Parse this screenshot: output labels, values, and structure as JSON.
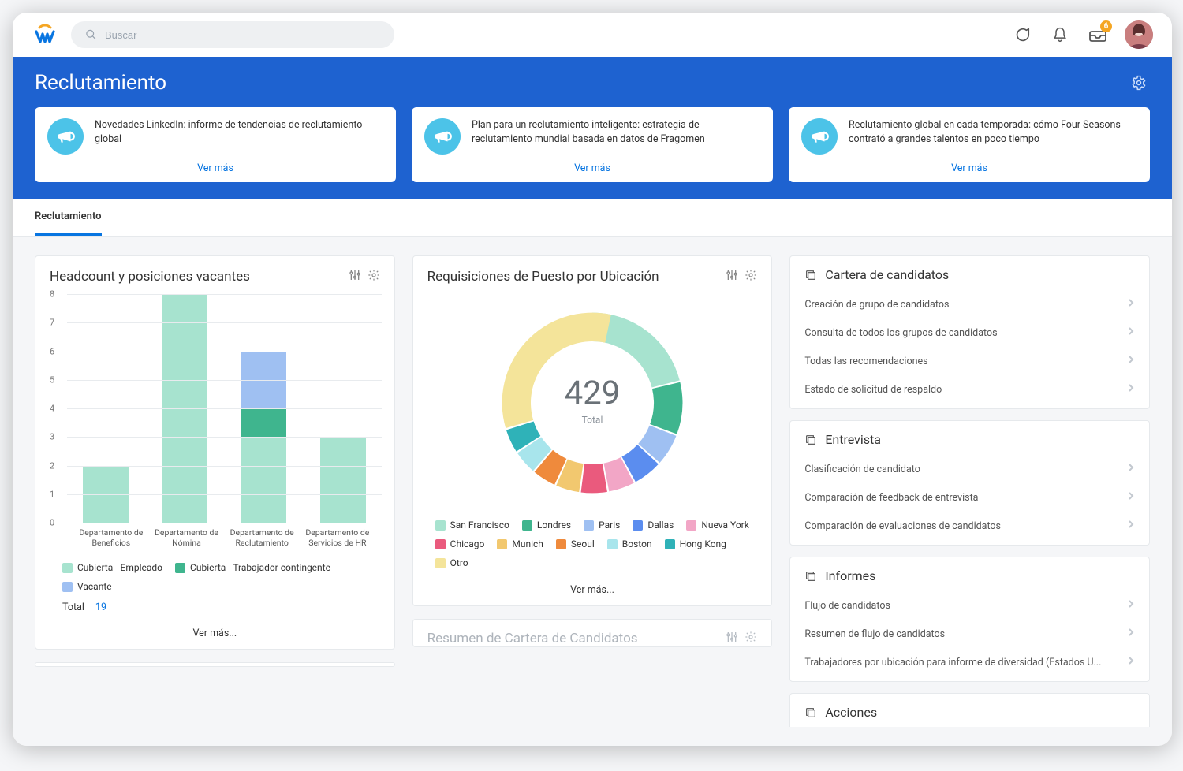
{
  "topbar": {
    "search_placeholder": "Buscar",
    "inbox_badge": "6"
  },
  "hero": {
    "title": "Reclutamiento",
    "cards": [
      {
        "text": "Novedades LinkedIn: informe de tendencias de reclutamiento global",
        "link": "Ver más"
      },
      {
        "text": "Plan para un reclutamiento inteligente: estrategia de reclutamiento mundial basada en datos de Fragomen",
        "link": "Ver más"
      },
      {
        "text": "Reclutamiento global en cada temporada: cómo Four Seasons contrató a grandes talentos en poco tiempo",
        "link": "Ver más"
      }
    ]
  },
  "tabs": {
    "active": "Reclutamiento"
  },
  "headcount": {
    "title": "Headcount y posiciones vacantes",
    "legend": {
      "filled_emp": "Cubierta - Empleado",
      "filled_cont": "Cubierta - Trabajador contingente",
      "vacant": "Vacante"
    },
    "total_label": "Total",
    "total_value": "19",
    "more": "Ver más..."
  },
  "requisitions": {
    "title": "Requisiciones de Puesto por Ubicación",
    "center_value": "429",
    "center_label": "Total",
    "legend": [
      "San Francisco",
      "Londres",
      "Paris",
      "Dallas",
      "Nueva York",
      "Chicago",
      "Munich",
      "Seoul",
      "Boston",
      "Hong Kong",
      "Otro"
    ],
    "more": "Ver más..."
  },
  "candidate_summary": {
    "title": "Resumen de Cartera de Candidatos"
  },
  "right": {
    "sections": [
      {
        "title": "Cartera de candidatos",
        "links": [
          "Creación de grupo de candidatos",
          "Consulta de todos los grupos de candidatos",
          "Todas las recomendaciones",
          "Estado de solicitud de respaldo"
        ]
      },
      {
        "title": "Entrevista",
        "links": [
          "Clasificación de candidato",
          "Comparación de feedback de entrevista",
          "Comparación de evaluaciones de candidatos"
        ]
      },
      {
        "title": "Informes",
        "links": [
          "Flujo de candidatos",
          "Resumen de flujo de candidatos",
          "Trabajadores por ubicación para informe de diversidad (Estados U..."
        ]
      },
      {
        "title": "Acciones",
        "links": []
      }
    ]
  },
  "chart_data": [
    {
      "type": "bar",
      "title": "Headcount y posiciones vacantes",
      "categories": [
        "Departamento de Beneficios",
        "Departamento de Nómina",
        "Departamento de Reclutamiento",
        "Departamento de Servicios de HR"
      ],
      "series": [
        {
          "name": "Cubierta - Empleado",
          "color": "#a7e3cf",
          "values": [
            2,
            8,
            3,
            3
          ]
        },
        {
          "name": "Cubierta - Trabajador contingente",
          "color": "#3fb58e",
          "values": [
            0,
            0,
            1,
            0
          ]
        },
        {
          "name": "Vacante",
          "color": "#9fc0f2",
          "values": [
            0,
            0,
            2,
            0
          ]
        }
      ],
      "ylim": [
        0,
        8
      ],
      "yticks": [
        0,
        1,
        2,
        3,
        4,
        5,
        6,
        7,
        8
      ],
      "total": 19
    },
    {
      "type": "pie",
      "title": "Requisiciones de Puesto por Ubicación",
      "total": 429,
      "slices": [
        {
          "name": "San Francisco",
          "color": "#a7e3cf",
          "value": 90
        },
        {
          "name": "Londres",
          "color": "#3fb58e",
          "value": 40
        },
        {
          "name": "Paris",
          "color": "#9fc0f2",
          "value": 24
        },
        {
          "name": "Dallas",
          "color": "#5b8def",
          "value": 22
        },
        {
          "name": "Nueva York",
          "color": "#f2a6c6",
          "value": 20
        },
        {
          "name": "Chicago",
          "color": "#ea5a7d",
          "value": 20
        },
        {
          "name": "Munich",
          "color": "#f2c86f",
          "value": 18
        },
        {
          "name": "Seoul",
          "color": "#ef8a3c",
          "value": 18
        },
        {
          "name": "Boston",
          "color": "#a8e5ec",
          "value": 18
        },
        {
          "name": "Hong Kong",
          "color": "#2fb2b8",
          "value": 18
        },
        {
          "name": "Otro",
          "color": "#f4e49a",
          "value": 141
        }
      ]
    }
  ]
}
